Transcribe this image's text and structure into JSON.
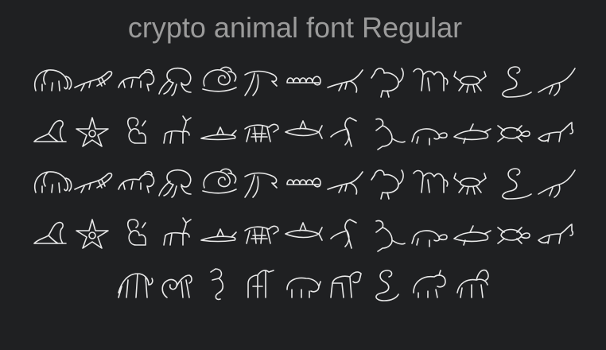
{
  "title": "crypto animal font Regular",
  "colors": {
    "background": "#1f2022",
    "title": "#9b9b9b",
    "glyph_stroke": "#e9e9e9"
  },
  "specimen_rows": [
    {
      "glyphs": [
        "elephant-icon",
        "lizard-icon",
        "lion-icon",
        "octopus-icon",
        "snail-shell-icon",
        "dolphin-icon",
        "caterpillar-icon",
        "bird-flying-icon",
        "rooster-icon",
        "camel-icon",
        "crab-icon",
        "snake-icon",
        "heron-icon"
      ]
    },
    {
      "glyphs": [
        "seal-icon",
        "starfish-icon",
        "squirrel-icon",
        "deer-icon",
        "shark-small-icon",
        "zebra-icon",
        "shark-icon",
        "crane-icon",
        "kangaroo-icon",
        "turtle-icon",
        "dolphin-swimming-icon",
        "sea-turtle-icon",
        "fox-icon"
      ]
    },
    {
      "glyphs": [
        "elephant-icon",
        "lizard-icon",
        "lion-icon",
        "octopus-icon",
        "snail-shell-icon",
        "dolphin-icon",
        "caterpillar-icon",
        "bird-flying-icon",
        "rooster-icon",
        "camel-icon",
        "crab-icon",
        "snake-icon",
        "heron-icon"
      ]
    },
    {
      "glyphs": [
        "seal-icon",
        "starfish-icon",
        "squirrel-icon",
        "deer-icon",
        "shark-small-icon",
        "zebra-icon",
        "shark-icon",
        "crane-icon",
        "kangaroo-icon",
        "turtle-icon",
        "dolphin-swimming-icon",
        "sea-turtle-icon",
        "fox-icon"
      ]
    },
    {
      "glyphs": [
        "tiger-icon",
        "monkey-icon",
        "seahorse-icon",
        "giraffe-icon",
        "rhino-icon",
        "horse-icon",
        "snake-coil-icon",
        "bear-icon",
        "goat-icon"
      ]
    }
  ]
}
